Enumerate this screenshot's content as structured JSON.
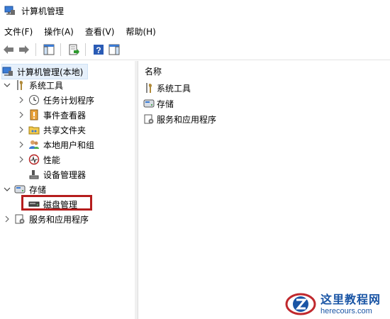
{
  "window": {
    "title": "计算机管理"
  },
  "menu": [
    "文件(F)",
    "操作(A)",
    "查看(V)",
    "帮助(H)"
  ],
  "tree": {
    "root": "计算机管理(本地)",
    "system_tools": "系统工具",
    "task_scheduler": "任务计划程序",
    "event_viewer": "事件查看器",
    "shared_folders": "共享文件夹",
    "local_users": "本地用户和组",
    "performance": "性能",
    "device_manager": "设备管理器",
    "storage": "存储",
    "disk_management": "磁盘管理",
    "services": "服务和应用程序"
  },
  "list": {
    "column_name": "名称",
    "items": [
      "系统工具",
      "存储",
      "服务和应用程序"
    ]
  },
  "watermark": {
    "cn": "这里教程网",
    "url": "herecours.com"
  },
  "colors": {
    "highlight": "#b51d1d",
    "selection": "#e6f0fb",
    "brand": "#1a55a5"
  }
}
